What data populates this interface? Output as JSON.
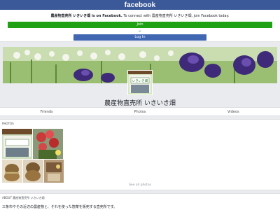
{
  "header": {
    "logo_text": "facebook",
    "brand_color": "#3b5998"
  },
  "promo": {
    "page_name": "農産物直売所 いきいき畑",
    "on_facebook": " is on Facebook.",
    "connect_text": " To connect with 農産物直売所 いきいき畑, join Facebook today.",
    "join_label": "Join",
    "or_label": "or",
    "login_label": "Log In",
    "join_color": "#1fa114",
    "login_color": "#4267b2"
  },
  "page": {
    "name": "農産物直売所 いきいき畑",
    "sign_text": "いきいき畑"
  },
  "tabs": [
    {
      "label": "Friends"
    },
    {
      "label": "Photos"
    },
    {
      "label": "Videos"
    }
  ],
  "photos": {
    "title": "PHOTOS",
    "see_all": "See all photos"
  },
  "about": {
    "title": "ABOUT 農産物直売所 いきいき畑",
    "description": "三条市やその近辺の農産物と、それを使った惣菜を販売する直売所です。"
  }
}
